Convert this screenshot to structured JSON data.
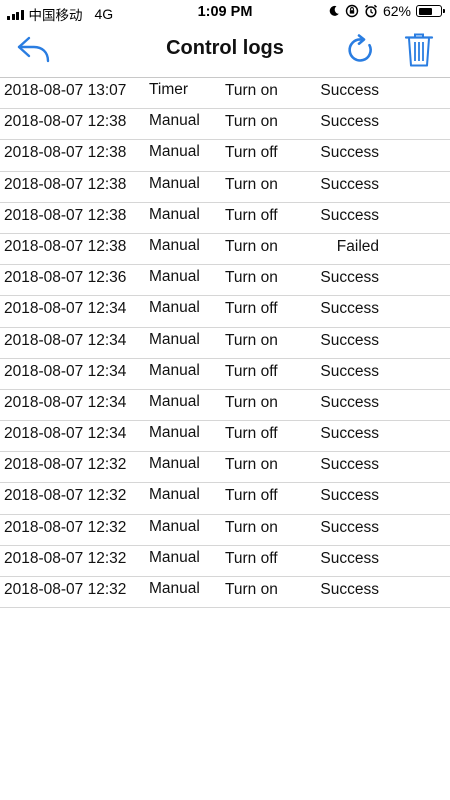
{
  "status_bar": {
    "carrier": "中国移动",
    "network": "4G",
    "time": "1:09 PM",
    "battery": "62%",
    "battery_level": 0.62
  },
  "nav": {
    "title": "Control logs",
    "back_icon": "back-arrow-icon",
    "refresh_icon": "refresh-icon",
    "delete_icon": "trash-icon",
    "accent_color": "#2a7de1"
  },
  "logs": [
    {
      "time": "2018-08-07 13:07",
      "mode": "Timer",
      "action": "Turn on",
      "result": "Success"
    },
    {
      "time": "2018-08-07 12:38",
      "mode": "Manual",
      "action": "Turn on",
      "result": "Success"
    },
    {
      "time": "2018-08-07 12:38",
      "mode": "Manual",
      "action": "Turn off",
      "result": "Success"
    },
    {
      "time": "2018-08-07 12:38",
      "mode": "Manual",
      "action": "Turn on",
      "result": "Success"
    },
    {
      "time": "2018-08-07 12:38",
      "mode": "Manual",
      "action": "Turn off",
      "result": "Success"
    },
    {
      "time": "2018-08-07 12:38",
      "mode": "Manual",
      "action": "Turn on",
      "result": "Failed"
    },
    {
      "time": "2018-08-07 12:36",
      "mode": "Manual",
      "action": "Turn on",
      "result": "Success"
    },
    {
      "time": "2018-08-07 12:34",
      "mode": "Manual",
      "action": "Turn off",
      "result": "Success"
    },
    {
      "time": "2018-08-07 12:34",
      "mode": "Manual",
      "action": "Turn on",
      "result": "Success"
    },
    {
      "time": "2018-08-07 12:34",
      "mode": "Manual",
      "action": "Turn off",
      "result": "Success"
    },
    {
      "time": "2018-08-07 12:34",
      "mode": "Manual",
      "action": "Turn on",
      "result": "Success"
    },
    {
      "time": "2018-08-07 12:34",
      "mode": "Manual",
      "action": "Turn off",
      "result": "Success"
    },
    {
      "time": "2018-08-07 12:32",
      "mode": "Manual",
      "action": "Turn on",
      "result": "Success"
    },
    {
      "time": "2018-08-07 12:32",
      "mode": "Manual",
      "action": "Turn off",
      "result": "Success"
    },
    {
      "time": "2018-08-07 12:32",
      "mode": "Manual",
      "action": "Turn on",
      "result": "Success"
    },
    {
      "time": "2018-08-07 12:32",
      "mode": "Manual",
      "action": "Turn off",
      "result": "Success"
    },
    {
      "time": "2018-08-07 12:32",
      "mode": "Manual",
      "action": "Turn on",
      "result": "Success"
    }
  ]
}
